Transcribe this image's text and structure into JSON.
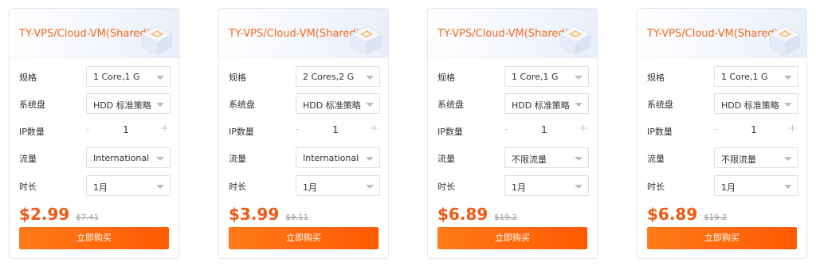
{
  "labels": {
    "spec": "规格",
    "disk": "系统盘",
    "ip_count": "IP数量",
    "traffic": "流量",
    "duration": "时长"
  },
  "cards": [
    {
      "title": "TY-VPS/Cloud-VM(Shared)",
      "spec": "1 Core,1 G",
      "disk": "HDD 标准策略 5",
      "ip_count": "1",
      "traffic": "International _",
      "duration": "1月",
      "price": "$2.99",
      "old_price": "$7.41",
      "buy_label": "立即购买"
    },
    {
      "title": "TY-VPS/Cloud-VM(Shared)",
      "spec": "2 Cores,2 G",
      "disk": "HDD 标准策略 5",
      "ip_count": "1",
      "traffic": "International _",
      "duration": "1月",
      "price": "$3.99",
      "old_price": "$9.11",
      "buy_label": "立即购买"
    },
    {
      "title": "TY-VPS/Cloud-VM(Shared)",
      "spec": "1 Core,1 G",
      "disk": "HDD 标准策略 5",
      "ip_count": "1",
      "traffic": "不限流量",
      "duration": "1月",
      "price": "$6.89",
      "old_price": "$19.2",
      "buy_label": "立即购买"
    },
    {
      "title": "TY-VPS/Cloud-VM(Shared)",
      "spec": "1 Core,1 G",
      "disk": "HDD 标准策略 5",
      "ip_count": "1",
      "traffic": "不限流量",
      "duration": "1月",
      "price": "$6.89",
      "old_price": "$19.2",
      "buy_label": "立即购买"
    }
  ],
  "stepper": {
    "minus": "-",
    "plus": "+"
  },
  "colors": {
    "accent": "#f05a14",
    "title": "#f06a1c",
    "button": "#ff6a0a"
  },
  "icons": {
    "header_art": "cube-illustration-icon",
    "dropdown": "chevron-down-icon"
  }
}
